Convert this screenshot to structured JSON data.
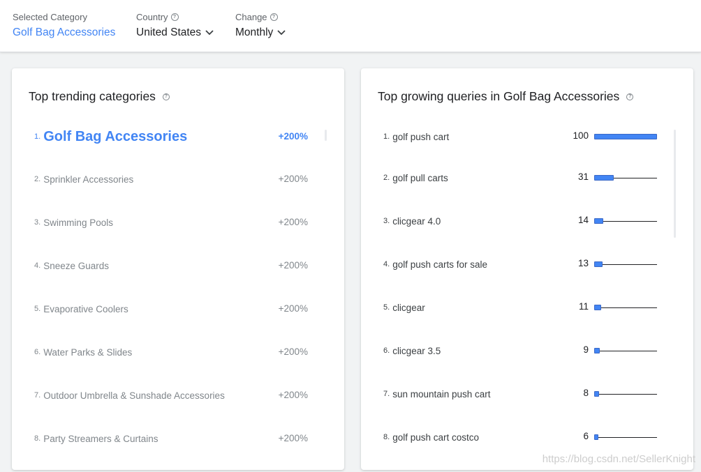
{
  "filters": {
    "category": {
      "label": "Selected Category",
      "value": "Golf Bag Accessories"
    },
    "country": {
      "label": "Country",
      "value": "United States"
    },
    "change": {
      "label": "Change",
      "value": "Monthly"
    }
  },
  "trending": {
    "title": "Top trending categories",
    "items": [
      {
        "rank": "1.",
        "name": "Golf Bag Accessories",
        "change": "+200%"
      },
      {
        "rank": "2.",
        "name": "Sprinkler Accessories",
        "change": "+200%"
      },
      {
        "rank": "3.",
        "name": "Swimming Pools",
        "change": "+200%"
      },
      {
        "rank": "4.",
        "name": "Sneeze Guards",
        "change": "+200%"
      },
      {
        "rank": "5.",
        "name": "Evaporative Coolers",
        "change": "+200%"
      },
      {
        "rank": "6.",
        "name": "Water Parks & Slides",
        "change": "+200%"
      },
      {
        "rank": "7.",
        "name": "Outdoor Umbrella & Sunshade Accessories",
        "change": "+200%"
      },
      {
        "rank": "8.",
        "name": "Party Streamers & Curtains",
        "change": "+200%"
      }
    ]
  },
  "queries": {
    "title": "Top growing queries in Golf Bag Accessories",
    "bar_color": "#4285f4",
    "items": [
      {
        "rank": "1.",
        "name": "golf push cart",
        "value": 100
      },
      {
        "rank": "2.",
        "name": "golf pull carts",
        "value": 31
      },
      {
        "rank": "3.",
        "name": "clicgear 4.0",
        "value": 14
      },
      {
        "rank": "4.",
        "name": "golf push carts for sale",
        "value": 13
      },
      {
        "rank": "5.",
        "name": "clicgear",
        "value": 11
      },
      {
        "rank": "6.",
        "name": "clicgear 3.5",
        "value": 9
      },
      {
        "rank": "7.",
        "name": "sun mountain push cart",
        "value": 8
      },
      {
        "rank": "8.",
        "name": "golf push cart costco",
        "value": 6
      }
    ]
  },
  "watermark": "https://blog.csdn.net/SellerKnight"
}
